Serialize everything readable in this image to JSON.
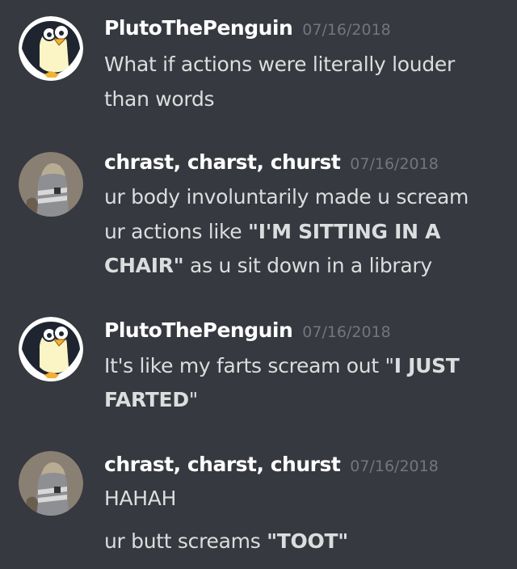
{
  "colors": {
    "background": "#36393f",
    "username": "#ffffff",
    "text": "#dcddde",
    "timestamp": "#72767d"
  },
  "messages": [
    {
      "author": "PlutoThePenguin",
      "timestamp": "07/16/2018",
      "avatar_icon": "penguin-avatar-icon",
      "lines": [
        {
          "text": "What if actions were literally louder"
        },
        {
          "text": "than words"
        }
      ]
    },
    {
      "author": "chrast, charst, churst",
      "timestamp": "07/16/2018",
      "avatar_icon": "hooded-figure-avatar-icon",
      "lines": [
        {
          "text": "ur body involuntarily made u scream"
        },
        {
          "pre": "ur actions like ",
          "bold": "\"I'M SITTING IN A"
        },
        {
          "bold": "CHAIR\"",
          "post": " as u sit down in a library"
        }
      ]
    },
    {
      "author": "PlutoThePenguin",
      "timestamp": "07/16/2018",
      "avatar_icon": "penguin-avatar-icon",
      "lines": [
        {
          "pre": "It's like my farts scream out \"",
          "bold": "I JUST"
        },
        {
          "bold": "FARTED",
          "post": "\""
        }
      ]
    },
    {
      "author": "chrast, charst, churst",
      "timestamp": "07/16/2018",
      "avatar_icon": "hooded-figure-avatar-icon",
      "lines": [
        {
          "text": "HAHAH"
        },
        {
          "pre": "ur butt screams ",
          "bold": "\"TOOT\""
        }
      ]
    }
  ]
}
